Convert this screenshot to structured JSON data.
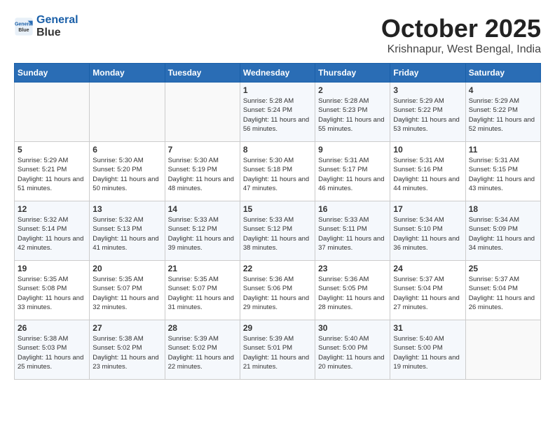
{
  "header": {
    "logo_line1": "General",
    "logo_line2": "Blue",
    "month": "October 2025",
    "location": "Krishnapur, West Bengal, India"
  },
  "weekdays": [
    "Sunday",
    "Monday",
    "Tuesday",
    "Wednesday",
    "Thursday",
    "Friday",
    "Saturday"
  ],
  "weeks": [
    [
      {
        "day": "",
        "sunrise": "",
        "sunset": "",
        "daylight": ""
      },
      {
        "day": "",
        "sunrise": "",
        "sunset": "",
        "daylight": ""
      },
      {
        "day": "",
        "sunrise": "",
        "sunset": "",
        "daylight": ""
      },
      {
        "day": "1",
        "sunrise": "Sunrise: 5:28 AM",
        "sunset": "Sunset: 5:24 PM",
        "daylight": "Daylight: 11 hours and 56 minutes."
      },
      {
        "day": "2",
        "sunrise": "Sunrise: 5:28 AM",
        "sunset": "Sunset: 5:23 PM",
        "daylight": "Daylight: 11 hours and 55 minutes."
      },
      {
        "day": "3",
        "sunrise": "Sunrise: 5:29 AM",
        "sunset": "Sunset: 5:22 PM",
        "daylight": "Daylight: 11 hours and 53 minutes."
      },
      {
        "day": "4",
        "sunrise": "Sunrise: 5:29 AM",
        "sunset": "Sunset: 5:22 PM",
        "daylight": "Daylight: 11 hours and 52 minutes."
      }
    ],
    [
      {
        "day": "5",
        "sunrise": "Sunrise: 5:29 AM",
        "sunset": "Sunset: 5:21 PM",
        "daylight": "Daylight: 11 hours and 51 minutes."
      },
      {
        "day": "6",
        "sunrise": "Sunrise: 5:30 AM",
        "sunset": "Sunset: 5:20 PM",
        "daylight": "Daylight: 11 hours and 50 minutes."
      },
      {
        "day": "7",
        "sunrise": "Sunrise: 5:30 AM",
        "sunset": "Sunset: 5:19 PM",
        "daylight": "Daylight: 11 hours and 48 minutes."
      },
      {
        "day": "8",
        "sunrise": "Sunrise: 5:30 AM",
        "sunset": "Sunset: 5:18 PM",
        "daylight": "Daylight: 11 hours and 47 minutes."
      },
      {
        "day": "9",
        "sunrise": "Sunrise: 5:31 AM",
        "sunset": "Sunset: 5:17 PM",
        "daylight": "Daylight: 11 hours and 46 minutes."
      },
      {
        "day": "10",
        "sunrise": "Sunrise: 5:31 AM",
        "sunset": "Sunset: 5:16 PM",
        "daylight": "Daylight: 11 hours and 44 minutes."
      },
      {
        "day": "11",
        "sunrise": "Sunrise: 5:31 AM",
        "sunset": "Sunset: 5:15 PM",
        "daylight": "Daylight: 11 hours and 43 minutes."
      }
    ],
    [
      {
        "day": "12",
        "sunrise": "Sunrise: 5:32 AM",
        "sunset": "Sunset: 5:14 PM",
        "daylight": "Daylight: 11 hours and 42 minutes."
      },
      {
        "day": "13",
        "sunrise": "Sunrise: 5:32 AM",
        "sunset": "Sunset: 5:13 PM",
        "daylight": "Daylight: 11 hours and 41 minutes."
      },
      {
        "day": "14",
        "sunrise": "Sunrise: 5:33 AM",
        "sunset": "Sunset: 5:12 PM",
        "daylight": "Daylight: 11 hours and 39 minutes."
      },
      {
        "day": "15",
        "sunrise": "Sunrise: 5:33 AM",
        "sunset": "Sunset: 5:12 PM",
        "daylight": "Daylight: 11 hours and 38 minutes."
      },
      {
        "day": "16",
        "sunrise": "Sunrise: 5:33 AM",
        "sunset": "Sunset: 5:11 PM",
        "daylight": "Daylight: 11 hours and 37 minutes."
      },
      {
        "day": "17",
        "sunrise": "Sunrise: 5:34 AM",
        "sunset": "Sunset: 5:10 PM",
        "daylight": "Daylight: 11 hours and 36 minutes."
      },
      {
        "day": "18",
        "sunrise": "Sunrise: 5:34 AM",
        "sunset": "Sunset: 5:09 PM",
        "daylight": "Daylight: 11 hours and 34 minutes."
      }
    ],
    [
      {
        "day": "19",
        "sunrise": "Sunrise: 5:35 AM",
        "sunset": "Sunset: 5:08 PM",
        "daylight": "Daylight: 11 hours and 33 minutes."
      },
      {
        "day": "20",
        "sunrise": "Sunrise: 5:35 AM",
        "sunset": "Sunset: 5:07 PM",
        "daylight": "Daylight: 11 hours and 32 minutes."
      },
      {
        "day": "21",
        "sunrise": "Sunrise: 5:35 AM",
        "sunset": "Sunset: 5:07 PM",
        "daylight": "Daylight: 11 hours and 31 minutes."
      },
      {
        "day": "22",
        "sunrise": "Sunrise: 5:36 AM",
        "sunset": "Sunset: 5:06 PM",
        "daylight": "Daylight: 11 hours and 29 minutes."
      },
      {
        "day": "23",
        "sunrise": "Sunrise: 5:36 AM",
        "sunset": "Sunset: 5:05 PM",
        "daylight": "Daylight: 11 hours and 28 minutes."
      },
      {
        "day": "24",
        "sunrise": "Sunrise: 5:37 AM",
        "sunset": "Sunset: 5:04 PM",
        "daylight": "Daylight: 11 hours and 27 minutes."
      },
      {
        "day": "25",
        "sunrise": "Sunrise: 5:37 AM",
        "sunset": "Sunset: 5:04 PM",
        "daylight": "Daylight: 11 hours and 26 minutes."
      }
    ],
    [
      {
        "day": "26",
        "sunrise": "Sunrise: 5:38 AM",
        "sunset": "Sunset: 5:03 PM",
        "daylight": "Daylight: 11 hours and 25 minutes."
      },
      {
        "day": "27",
        "sunrise": "Sunrise: 5:38 AM",
        "sunset": "Sunset: 5:02 PM",
        "daylight": "Daylight: 11 hours and 23 minutes."
      },
      {
        "day": "28",
        "sunrise": "Sunrise: 5:39 AM",
        "sunset": "Sunset: 5:02 PM",
        "daylight": "Daylight: 11 hours and 22 minutes."
      },
      {
        "day": "29",
        "sunrise": "Sunrise: 5:39 AM",
        "sunset": "Sunset: 5:01 PM",
        "daylight": "Daylight: 11 hours and 21 minutes."
      },
      {
        "day": "30",
        "sunrise": "Sunrise: 5:40 AM",
        "sunset": "Sunset: 5:00 PM",
        "daylight": "Daylight: 11 hours and 20 minutes."
      },
      {
        "day": "31",
        "sunrise": "Sunrise: 5:40 AM",
        "sunset": "Sunset: 5:00 PM",
        "daylight": "Daylight: 11 hours and 19 minutes."
      },
      {
        "day": "",
        "sunrise": "",
        "sunset": "",
        "daylight": ""
      }
    ]
  ]
}
